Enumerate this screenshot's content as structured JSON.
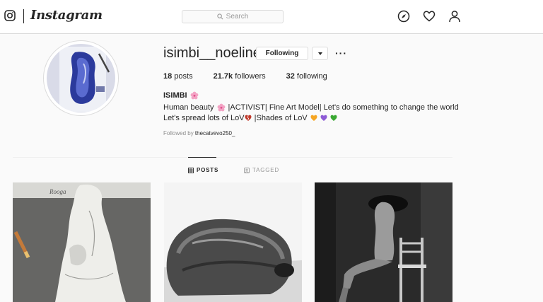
{
  "nav": {
    "brand": "Instagram",
    "search_placeholder": "Search",
    "icons": [
      "instagram-glyph-icon",
      "compass-icon",
      "heart-icon",
      "person-icon"
    ]
  },
  "profile": {
    "username": "isimbi__noeline",
    "follow_label": "Following",
    "posts_count": "18",
    "posts_label": "posts",
    "followers_count": "21.7k",
    "followers_label": "followers",
    "following_count": "32",
    "following_label": "following",
    "name": "ISIMBI",
    "bio_line1_a": "Human beauty",
    "bio_line1_b": "|ACTIVIST| Fine Art Model| Let's do something to change the world",
    "bio_line2_a": "Let's spread lots of LoV",
    "bio_line2_b": "|Shades of LoV",
    "followed_by_prefix": "Followed by",
    "followed_by_user": "thecatvevo250_"
  },
  "tabs": [
    {
      "label": "POSTS",
      "active": true
    },
    {
      "label": "TAGGED",
      "active": false
    }
  ],
  "colors": {
    "text": "#262626",
    "secondary": "#8e8e8e",
    "border": "#dbdbdb",
    "background": "#fafafa",
    "heart_orange": "#f6a623",
    "heart_purple": "#8e5bd6",
    "heart_green": "#3aa832"
  }
}
